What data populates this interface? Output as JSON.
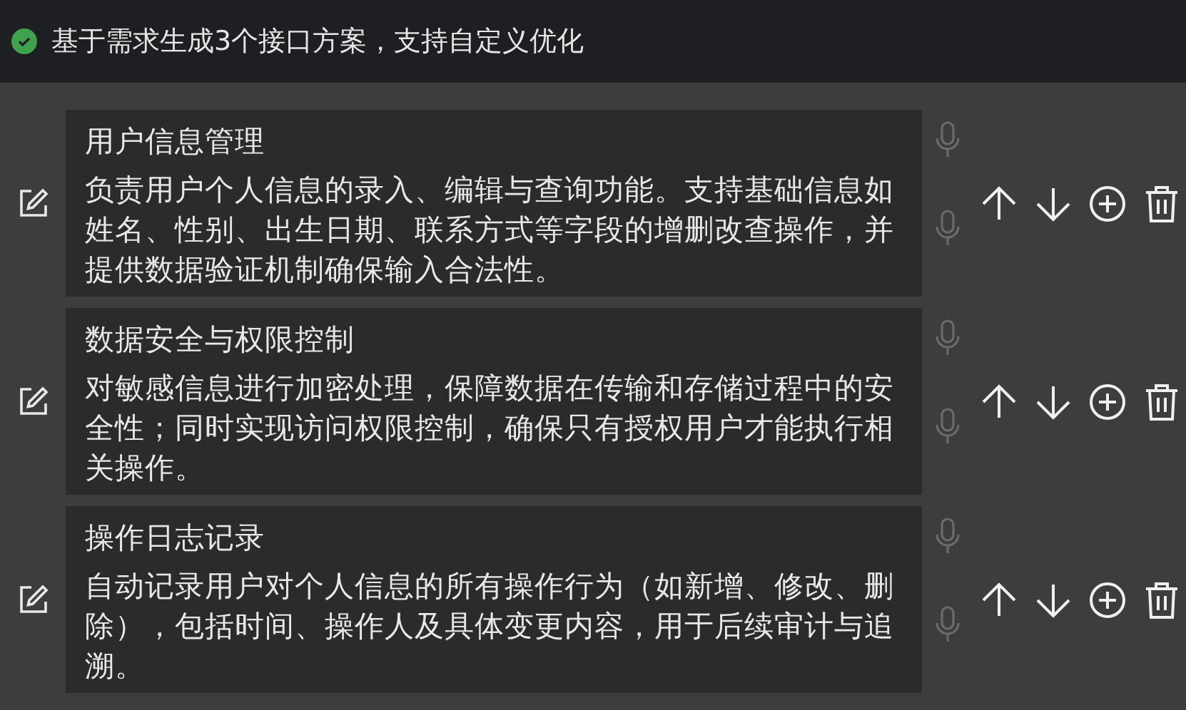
{
  "header": {
    "completed": true,
    "text": "基于需求生成3个接口方案，支持自定义优化"
  },
  "items": [
    {
      "title": "用户信息管理",
      "description": "负责用户个人信息的录入、编辑与查询功能。支持基础信息如姓名、性别、出生日期、联系方式等字段的增删改查操作，并提供数据验证机制确保输入合法性。"
    },
    {
      "title": "数据安全与权限控制",
      "description": "对敏感信息进行加密处理，保障数据在传输和存储过程中的安全性；同时实现访问权限控制，确保只有授权用户才能执行相关操作。"
    },
    {
      "title": "操作日志记录",
      "description": "自动记录用户对个人信息的所有操作行为（如新增、修改、删除），包括时间、操作人及具体变更内容，用于后续审计与追溯。"
    }
  ]
}
